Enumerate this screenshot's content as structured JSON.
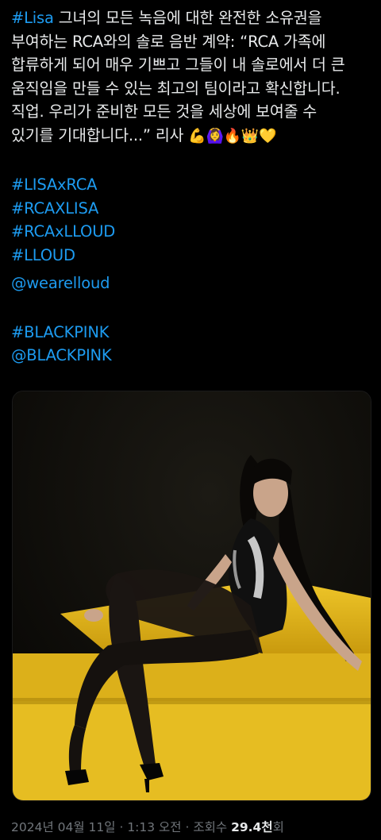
{
  "tweet": {
    "hashtag_lisa": "#Lisa",
    "line1_rest": " 그녀의 모든 녹음에 대한 완전한 소유권을",
    "line2": "부여하는 RCA와의 솔로 음반 계약: “RCA 가족에",
    "line3": "합류하게 되어 매우 기쁘고 그들이 내 솔로에서 더 큰",
    "line4": "움직임을 만들 수 있는 최고의 팀이라고 확신합니다.",
    "line5": "직업. 우리가 준비한 모든 것을 세상에 보여줄 수",
    "line6": "있기를 기대합니다...” 리사 ",
    "emojis": "💪🙆‍♀️🔥👑💛",
    "links": [
      "#LISAxRCA",
      "#RCAXLISA",
      "#RCAxLLOUD",
      "#LLOUD"
    ],
    "mention_lloud": "@wearelloud",
    "hashtag_blackpink": "#BLACKPINK",
    "mention_blackpink": "@BLACKPINK"
  },
  "media": {
    "description_colors": {
      "backdrop": "#0b0a07",
      "yellow_step": "#e0b81c",
      "bodysuit": "#101010"
    }
  },
  "meta": {
    "date": "2024년 04월 11일",
    "separator": " · ",
    "time": "1:13 오전",
    "views_label": "조회수 ",
    "views_count": "29.4천",
    "views_suffix": "회"
  },
  "colors": {
    "background": "#000000",
    "text": "#e7e9ea",
    "link": "#1d9bf0",
    "secondary": "#71767b"
  }
}
